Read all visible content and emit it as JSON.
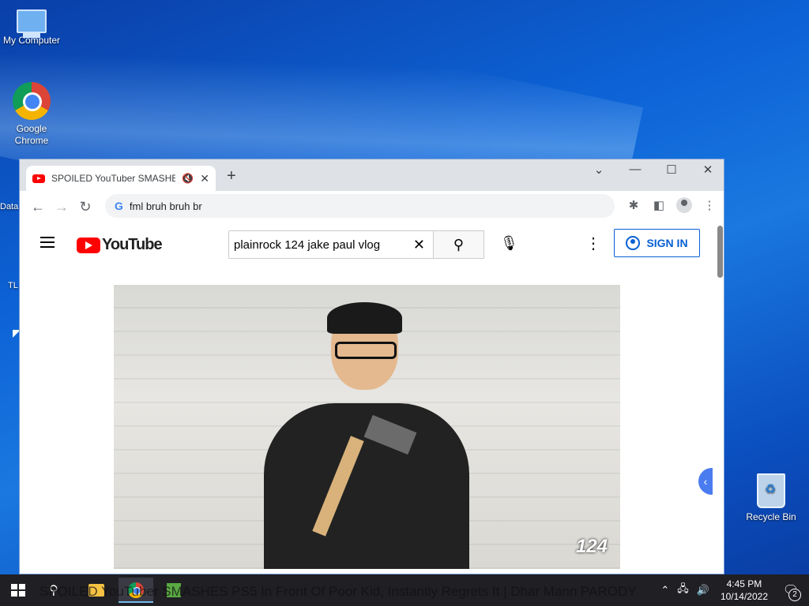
{
  "desktop": {
    "icons": [
      {
        "label": "My Computer"
      },
      {
        "label": "Google Chrome"
      },
      {
        "label": "Recycle Bin"
      }
    ],
    "partial_labels": [
      "Data",
      "TL"
    ]
  },
  "browser": {
    "tab_title": "SPOILED YouTuber SMASHES",
    "new_tab": "+",
    "url": "fml bruh bruh br",
    "window_controls": [
      "chevron-down",
      "minimize",
      "maximize",
      "close"
    ]
  },
  "youtube": {
    "logo_text": "YouTube",
    "search_value": "plainrock 124 jake paul vlog",
    "sign_in": "SIGN IN",
    "video_watermark": "124"
  },
  "taskbar": {
    "overlay_title": "SPOILED YouTuber SMASHES PS5 In Front Of Poor Kid, Instantly Regrets It | Dhar Mann PARODY",
    "time": "4:45 PM",
    "date": "10/14/2022",
    "notification_count": "2"
  },
  "colors": {
    "youtube_red": "#ff0000",
    "signin_blue": "#065fd4",
    "taskbar": "#1f1f24"
  }
}
